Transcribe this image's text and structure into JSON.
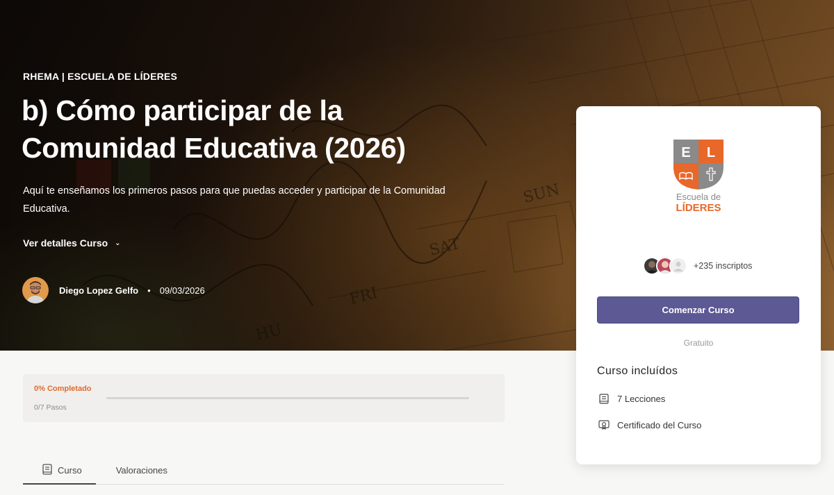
{
  "hero": {
    "breadcrumb": "RHEMA | ESCUELA DE LÍDERES",
    "title": "b) Cómo participar de la Comunidad Educativa (2026)",
    "subtitle": "Aquí te enseñamos los primeros pasos para que puedas acceder y participar de la Comunidad Educativa.",
    "details_label": "Ver detalles Curso",
    "author_name": "Diego Lopez Gelfo",
    "separator": "•",
    "date": "09/03/2026"
  },
  "progress": {
    "percent_label": "0% Completado",
    "steps_label": "0/7 Pasos",
    "fraction": 0
  },
  "tabs": [
    {
      "label": "Curso",
      "icon": "book-icon",
      "active": true
    },
    {
      "label": "Valoraciones",
      "active": false
    }
  ],
  "card": {
    "logo_letters": [
      "E",
      "L"
    ],
    "logo_line1": "Escuela de",
    "logo_line2": "LÍDERES",
    "enrolled_text": "+235 inscriptos",
    "start_button": "Comenzar Curso",
    "price": "Gratuito",
    "includes_title": "Curso incluídos",
    "includes": [
      {
        "icon": "lessons-icon",
        "label": "7 Lecciones"
      },
      {
        "icon": "certificate-icon",
        "label": "Certificado del Curso"
      }
    ]
  },
  "colors": {
    "accent_orange": "#e06a2a",
    "button_purple": "#5d5995",
    "logo_gray": "#8a8a8a"
  }
}
